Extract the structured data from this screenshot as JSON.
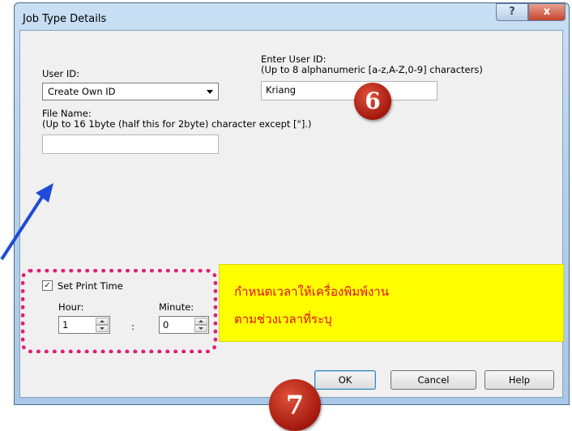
{
  "window": {
    "title": "Job Type Details",
    "help_glyph": "?",
    "close_glyph": "x"
  },
  "user_id": {
    "label": "User ID:",
    "selected": "Create Own ID"
  },
  "enter_user_id": {
    "label": "Enter User ID:",
    "hint": "(Up to 8 alphanumeric [a-z,A-Z,0-9] characters)",
    "value": "Kriang"
  },
  "file_name": {
    "label": "File Name:",
    "hint": "(Up to 16 1byte (half this for 2byte) character except [\"].)",
    "value": ""
  },
  "print_time": {
    "checkbox_label": "Set Print Time",
    "checked": true,
    "hour_label": "Hour:",
    "hour_value": "1",
    "separator": ":",
    "minute_label": "Minute:",
    "minute_value": "0"
  },
  "annotations": {
    "badge_6": "6",
    "badge_7": "7",
    "note_line1": "กำหนดเวลาให้เครื่องพิมพ์งาน",
    "note_line2": "ตามช่วงเวลาที่ระบุ",
    "arrow_color": "#1f4bd6",
    "badge_color": "#b81d10",
    "highlight_color": "#ffff00",
    "dotted_color": "#e01e78"
  },
  "buttons": {
    "ok": "OK",
    "cancel": "Cancel",
    "help": "Help"
  }
}
